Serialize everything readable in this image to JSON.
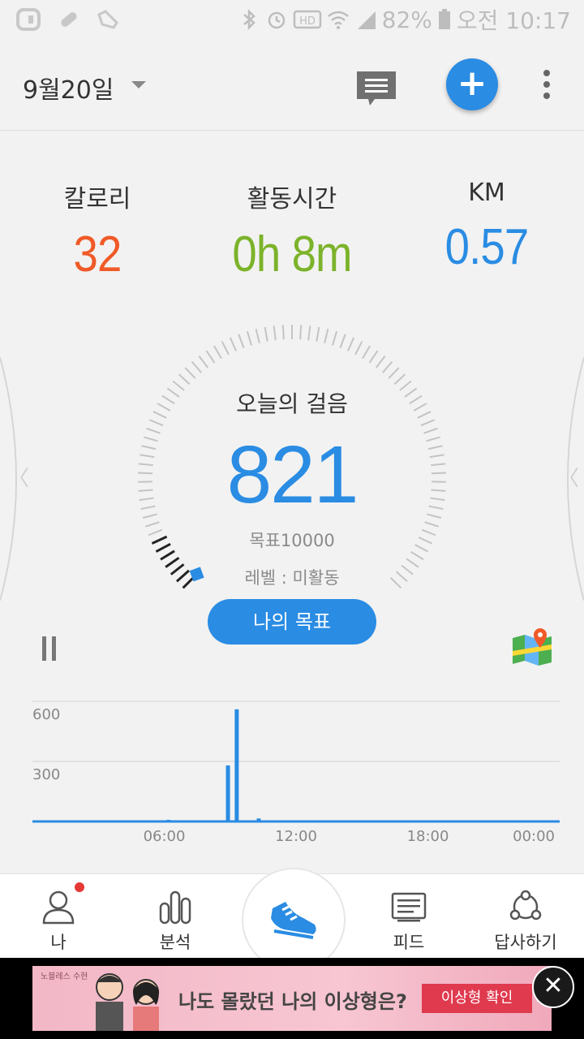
{
  "status_bar": {
    "battery": "82%",
    "time": "오전 10:17"
  },
  "header": {
    "date": "9월20일"
  },
  "stats": [
    {
      "label": "칼로리",
      "value": "32",
      "color": "#f05a28"
    },
    {
      "label": "활동시간",
      "value": "0h 8m",
      "color": "#7cb32a"
    },
    {
      "label": "KM",
      "value": "0.57",
      "color": "#2a8ce3"
    }
  ],
  "steps_panel": {
    "title": "오늘의 걸음",
    "steps": "821",
    "goal": "목표10000",
    "level": "레벨 : 미활동",
    "goal_button": "나의 목표",
    "progress_fraction": 0.0821
  },
  "chart_data": {
    "type": "bar",
    "x_ticks": [
      "06:00",
      "12:00",
      "18:00",
      "00:00"
    ],
    "y_ticks": [
      "600",
      "300"
    ],
    "ylim": [
      0,
      600
    ],
    "xlim_hours": [
      0,
      24
    ],
    "bars": [
      {
        "hour": 6.2,
        "value": 8
      },
      {
        "hour": 8.9,
        "value": 280
      },
      {
        "hour": 9.3,
        "value": 560
      },
      {
        "hour": 10.3,
        "value": 15
      }
    ],
    "color": "#2a8ce3"
  },
  "bottom_nav": [
    {
      "label": "나",
      "icon": "person-icon"
    },
    {
      "label": "분석",
      "icon": "bar-chart-icon"
    },
    {
      "label": "",
      "icon": "shoe-icon"
    },
    {
      "label": "피드",
      "icon": "feed-icon"
    },
    {
      "label": "답사하기",
      "icon": "share-circle-icon"
    }
  ],
  "ad": {
    "brand": "노블레스 수현",
    "headline": "나도 몰랐던 나의 이상형은?",
    "cta": "이상형 확인"
  }
}
